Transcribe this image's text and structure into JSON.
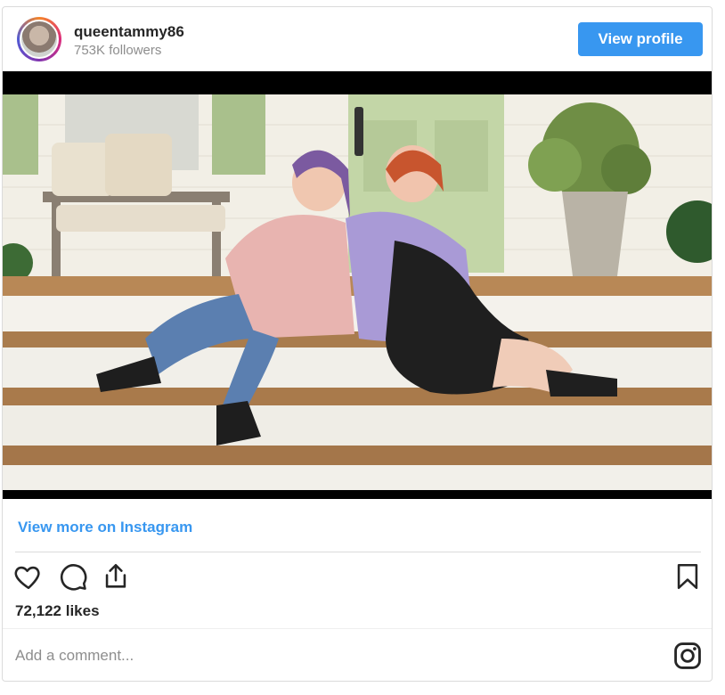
{
  "header": {
    "username": "queentammy86",
    "followers": "753K followers",
    "view_profile_label": "View profile"
  },
  "post": {
    "view_more_label": "View more on Instagram",
    "likes": "72,122 likes",
    "comment_placeholder": "Add a comment..."
  },
  "icons": {
    "like": "heart-icon",
    "comment": "comment-icon",
    "share": "share-icon",
    "save": "bookmark-icon",
    "instagram": "instagram-icon"
  },
  "colors": {
    "accent": "#3897f0",
    "text": "#262626",
    "muted": "#8e8e8e"
  }
}
